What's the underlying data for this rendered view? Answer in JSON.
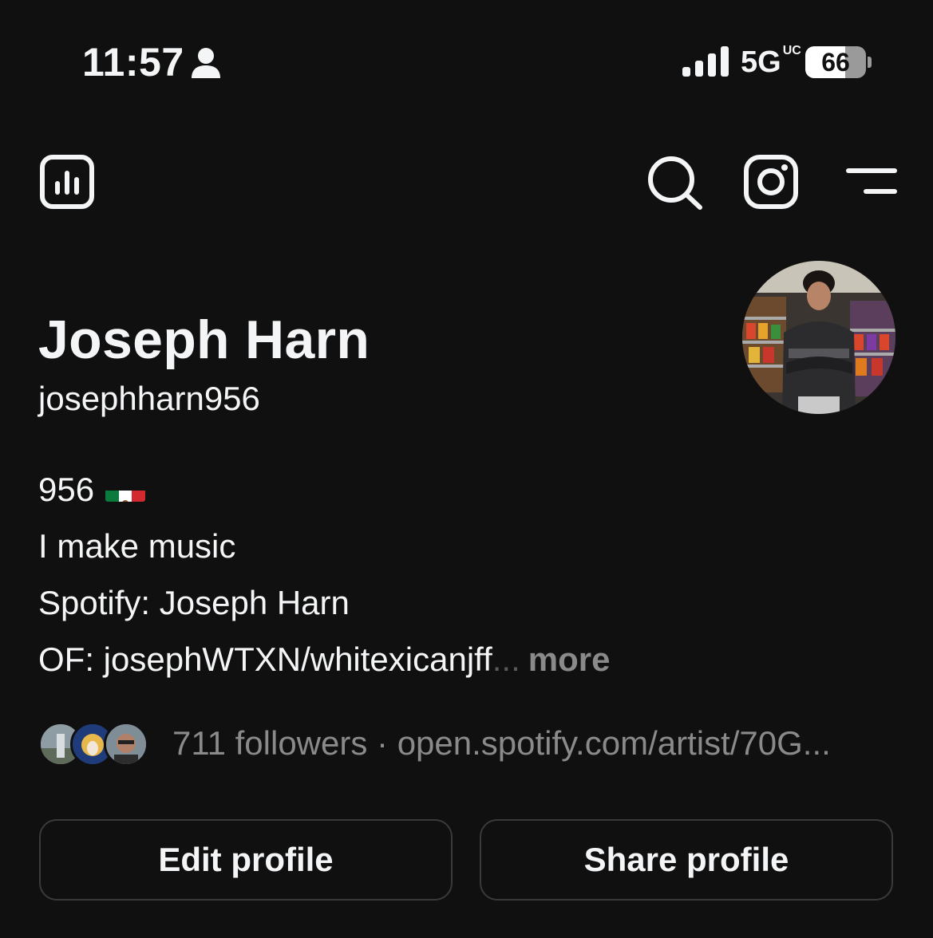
{
  "status_bar": {
    "time": "11:57",
    "network": "5G",
    "network_sup": "UC",
    "battery": "66",
    "battery_level": 0.66
  },
  "header": {
    "icons": [
      "insights-icon",
      "search-icon",
      "instagram-icon",
      "menu-icon"
    ]
  },
  "profile": {
    "name": "Joseph Harn",
    "handle": "josephharn956",
    "bio": {
      "line1": "956",
      "flag": "mexico-flag",
      "line2": "I make music",
      "line3": "Spotify: Joseph Harn",
      "line4": "OF: josephWTXN/whitexicanjff",
      "ellipsis": "...",
      "more": "more"
    },
    "followers": "711 followers",
    "separator": " · ",
    "link": "open.spotify.com/artist/70G..."
  },
  "buttons": {
    "edit": "Edit profile",
    "share": "Share profile"
  },
  "colors": {
    "background": "#101010",
    "text": "#f3f5f7",
    "secondary": "#8a8a8a",
    "border": "#3a3a3a"
  }
}
